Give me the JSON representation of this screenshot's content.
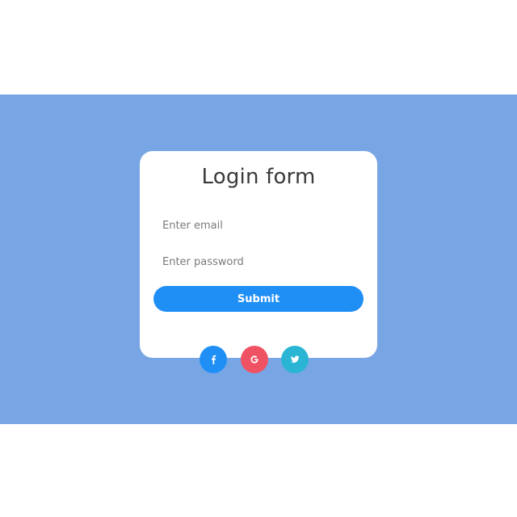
{
  "form": {
    "title": "Login form",
    "email_placeholder": "Enter email",
    "password_placeholder": "Enter password",
    "submit_label": "Submit"
  },
  "social": [
    {
      "icon": "facebook-icon",
      "glyph": "f",
      "color": "#1f8ff6"
    },
    {
      "icon": "google-icon",
      "glyph": "G",
      "color": "#ef5263"
    },
    {
      "icon": "twitter-icon",
      "glyph": "bird",
      "color": "#2ab5d5"
    }
  ],
  "colors": {
    "band": "#78a6e4",
    "card": "#ffffff",
    "submit": "#1f8ff6",
    "title_text": "#3a3a3a"
  }
}
